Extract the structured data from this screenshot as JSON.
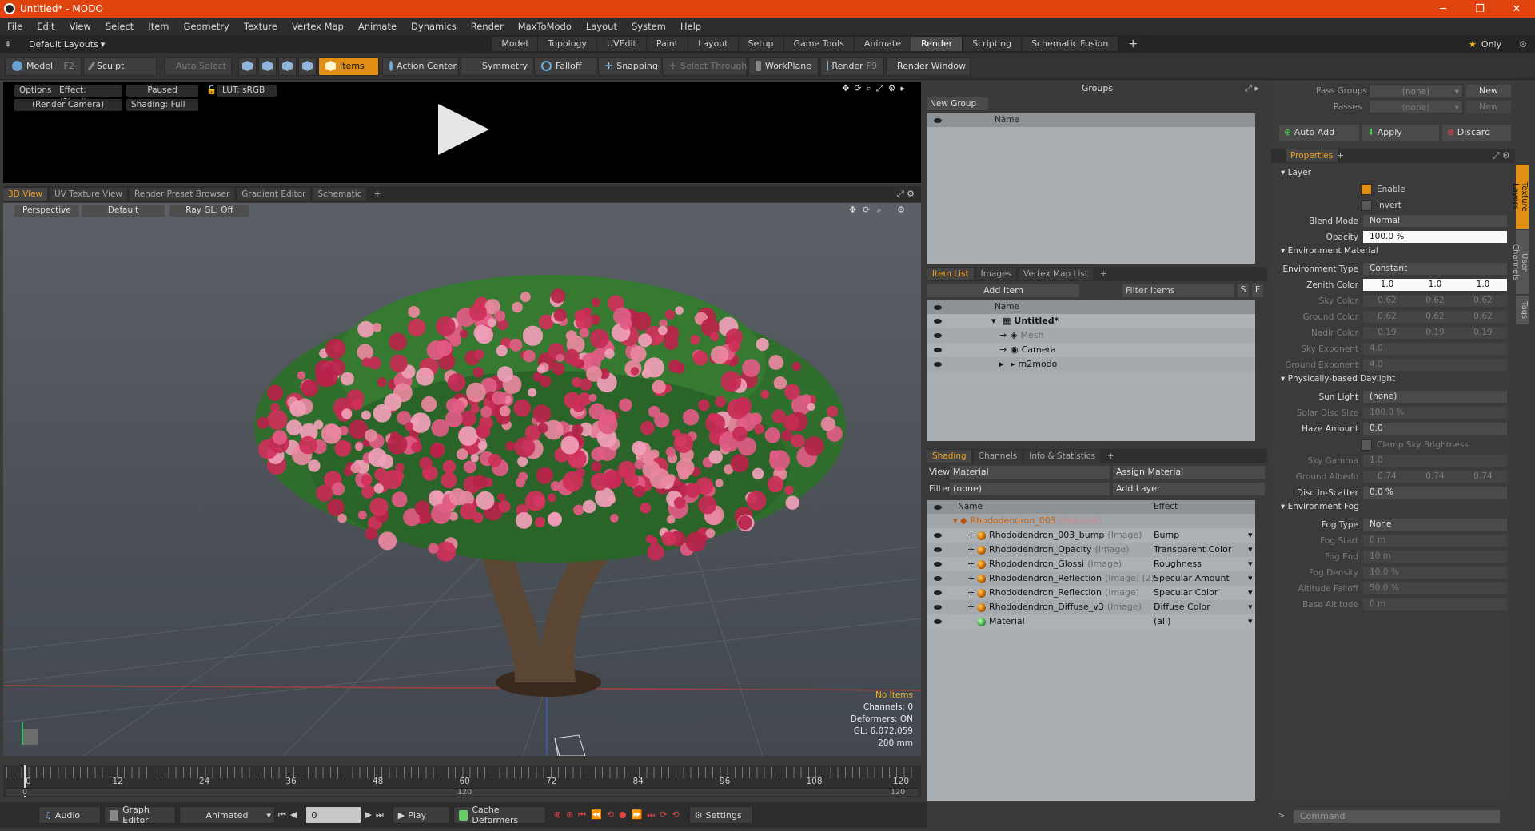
{
  "title": "Untitled* - MODO",
  "window_buttons": [
    "─",
    "❐",
    "✕"
  ],
  "menu": [
    "File",
    "Edit",
    "View",
    "Select",
    "Item",
    "Geometry",
    "Texture",
    "Vertex Map",
    "Animate",
    "Dynamics",
    "Render",
    "MaxToModo",
    "Layout",
    "System",
    "Help"
  ],
  "layouts_dropdown": "Default Layouts",
  "layout_tabs": [
    "Model",
    "Topology",
    "UVEdit",
    "Paint",
    "Layout",
    "Setup",
    "Game Tools",
    "Animate",
    "Render",
    "Scripting",
    "Schematic Fusion"
  ],
  "active_layout": "Render",
  "only_label": "Only",
  "toolbar": {
    "model": "Model",
    "model_key": "F2",
    "sculpt": "Sculpt",
    "auto_select": "Auto Select",
    "items": "Items",
    "action_center": "Action Center",
    "symmetry": "Symmetry",
    "falloff": "Falloff",
    "snapping": "Snapping",
    "select_through": "Select Through",
    "workplane": "WorkPlane",
    "render": "Render",
    "render_key": "F9",
    "render_window": "Render Window"
  },
  "render_preview": {
    "options": "Options",
    "effect": "Effect: (Shadi...",
    "paused": "Paused",
    "lut": "LUT: sRGB",
    "camera": "(Render Camera)",
    "shading": "Shading: Full"
  },
  "viewport_tabs": [
    "3D View",
    "UV Texture View",
    "Render Preset Browser",
    "Gradient Editor",
    "Schematic"
  ],
  "viewport": {
    "perspective": "Perspective",
    "default": "Default",
    "raygl": "Ray GL: Off",
    "info": [
      "No Items",
      "Channels: 0",
      "Deformers: ON",
      "GL: 6,072,059",
      "200 mm"
    ]
  },
  "timeline": {
    "ticks": [
      "0",
      "12",
      "24",
      "36",
      "48",
      "60",
      "72",
      "84",
      "96",
      "108",
      "120"
    ],
    "sub_ticks": [
      "0",
      "120",
      "120"
    ]
  },
  "bottom_bar": {
    "audio": "Audio",
    "graph_editor": "Graph Editor",
    "animated": "Animated",
    "frame": "0",
    "play": "Play",
    "cache_deformers": "Cache Deformers",
    "settings": "Settings"
  },
  "groups": {
    "title": "Groups",
    "new_group": "New Group",
    "name_col": "Name"
  },
  "item_list": {
    "tabs": [
      "Item List",
      "Images",
      "Vertex Map List"
    ],
    "add_item": "Add Item",
    "filter": "Filter Items",
    "s": "S",
    "f": "F",
    "name_col": "Name",
    "items": [
      {
        "name": "Untitled*",
        "indent": 0
      },
      {
        "name": "Mesh",
        "indent": 1,
        "dim": true
      },
      {
        "name": "Camera",
        "indent": 1
      },
      {
        "name": "m2modo",
        "indent": 1
      }
    ]
  },
  "shading": {
    "tabs": [
      "Shading",
      "Channels",
      "Info & Statistics"
    ],
    "view_label": "View",
    "view_value": "Material",
    "assign": "Assign Material",
    "filter_label": "Filter",
    "filter_value": "(none)",
    "add_layer": "Add Layer",
    "f": "F",
    "s": "S",
    "col_name": "Name",
    "col_effect": "Effect",
    "root": {
      "name": "Rhododendron_003",
      "type": "(Material)"
    },
    "layers": [
      {
        "name": "Rhododendron_003_bump",
        "type": "(Image)",
        "effect": "Bump"
      },
      {
        "name": "Rhododendron_Opacity",
        "type": "(Image)",
        "effect": "Transparent Color"
      },
      {
        "name": "Rhododendron_Glossi",
        "type": "(Image)",
        "effect": "Roughness"
      },
      {
        "name": "Rhododendron_Reflection",
        "type": "(Image) (2)",
        "effect": "Specular Amount"
      },
      {
        "name": "Rhododendron_Reflection",
        "type": "(Image)",
        "effect": "Specular Color"
      },
      {
        "name": "Rhododendron_Diffuse_v3",
        "type": "(Image)",
        "effect": "Diffuse Color"
      },
      {
        "name": "Material",
        "type": "",
        "effect": "(all)"
      }
    ]
  },
  "passes": {
    "pass_groups": "Pass Groups",
    "passes": "Passes",
    "none": "(none)",
    "new": "New",
    "auto_add": "Auto Add",
    "apply": "Apply",
    "discard": "Discard"
  },
  "properties": {
    "tab": "Properties",
    "layer_section": "Layer",
    "enable": "Enable",
    "invert": "Invert",
    "blend_mode": "Blend Mode",
    "blend_value": "Normal",
    "opacity": "Opacity",
    "opacity_value": "100.0 %",
    "env_section": "Environment Material",
    "env_type": "Environment Type",
    "env_type_value": "Constant",
    "zenith": "Zenith Color",
    "zenith_vals": [
      "1.0",
      "1.0",
      "1.0"
    ],
    "sky": "Sky Color",
    "sky_vals": [
      "0.62",
      "0.62",
      "0.62"
    ],
    "ground": "Ground Color",
    "ground_vals": [
      "0.62",
      "0.62",
      "0.62"
    ],
    "nadir": "Nadir Color",
    "nadir_vals": [
      "0.19",
      "0.19",
      "0.19"
    ],
    "sky_exp": "Sky Exponent",
    "sky_exp_value": "4.0",
    "ground_exp": "Ground Exponent",
    "ground_exp_value": "4.0",
    "daylight_section": "Physically-based Daylight",
    "sun_light": "Sun Light",
    "sun_light_value": "(none)",
    "solar_disc": "Solar Disc Size",
    "solar_disc_value": "100.0 %",
    "haze": "Haze Amount",
    "haze_value": "0.0",
    "clamp": "Clamp Sky Brightness",
    "sky_gamma": "Sky Gamma",
    "sky_gamma_value": "1.0",
    "ground_albedo": "Ground Albedo",
    "albedo_vals": [
      "0.74",
      "0.74",
      "0.74"
    ],
    "disc_in": "Disc In-Scatter",
    "disc_in_value": "0.0 %",
    "fog_section": "Environment Fog",
    "fog_type": "Fog Type",
    "fog_type_value": "None",
    "fog_start": "Fog Start",
    "fog_start_value": "0 m",
    "fog_end": "Fog End",
    "fog_end_value": "10 m",
    "fog_density": "Fog Density",
    "fog_density_value": "10.0 %",
    "alt_falloff": "Altitude Falloff",
    "alt_falloff_value": "50.0 %",
    "base_alt": "Base Altitude",
    "base_alt_value": "0 m"
  },
  "side_tabs": [
    "Texture Layers",
    "User Channels",
    "Tags"
  ],
  "command_placeholder": "Command"
}
